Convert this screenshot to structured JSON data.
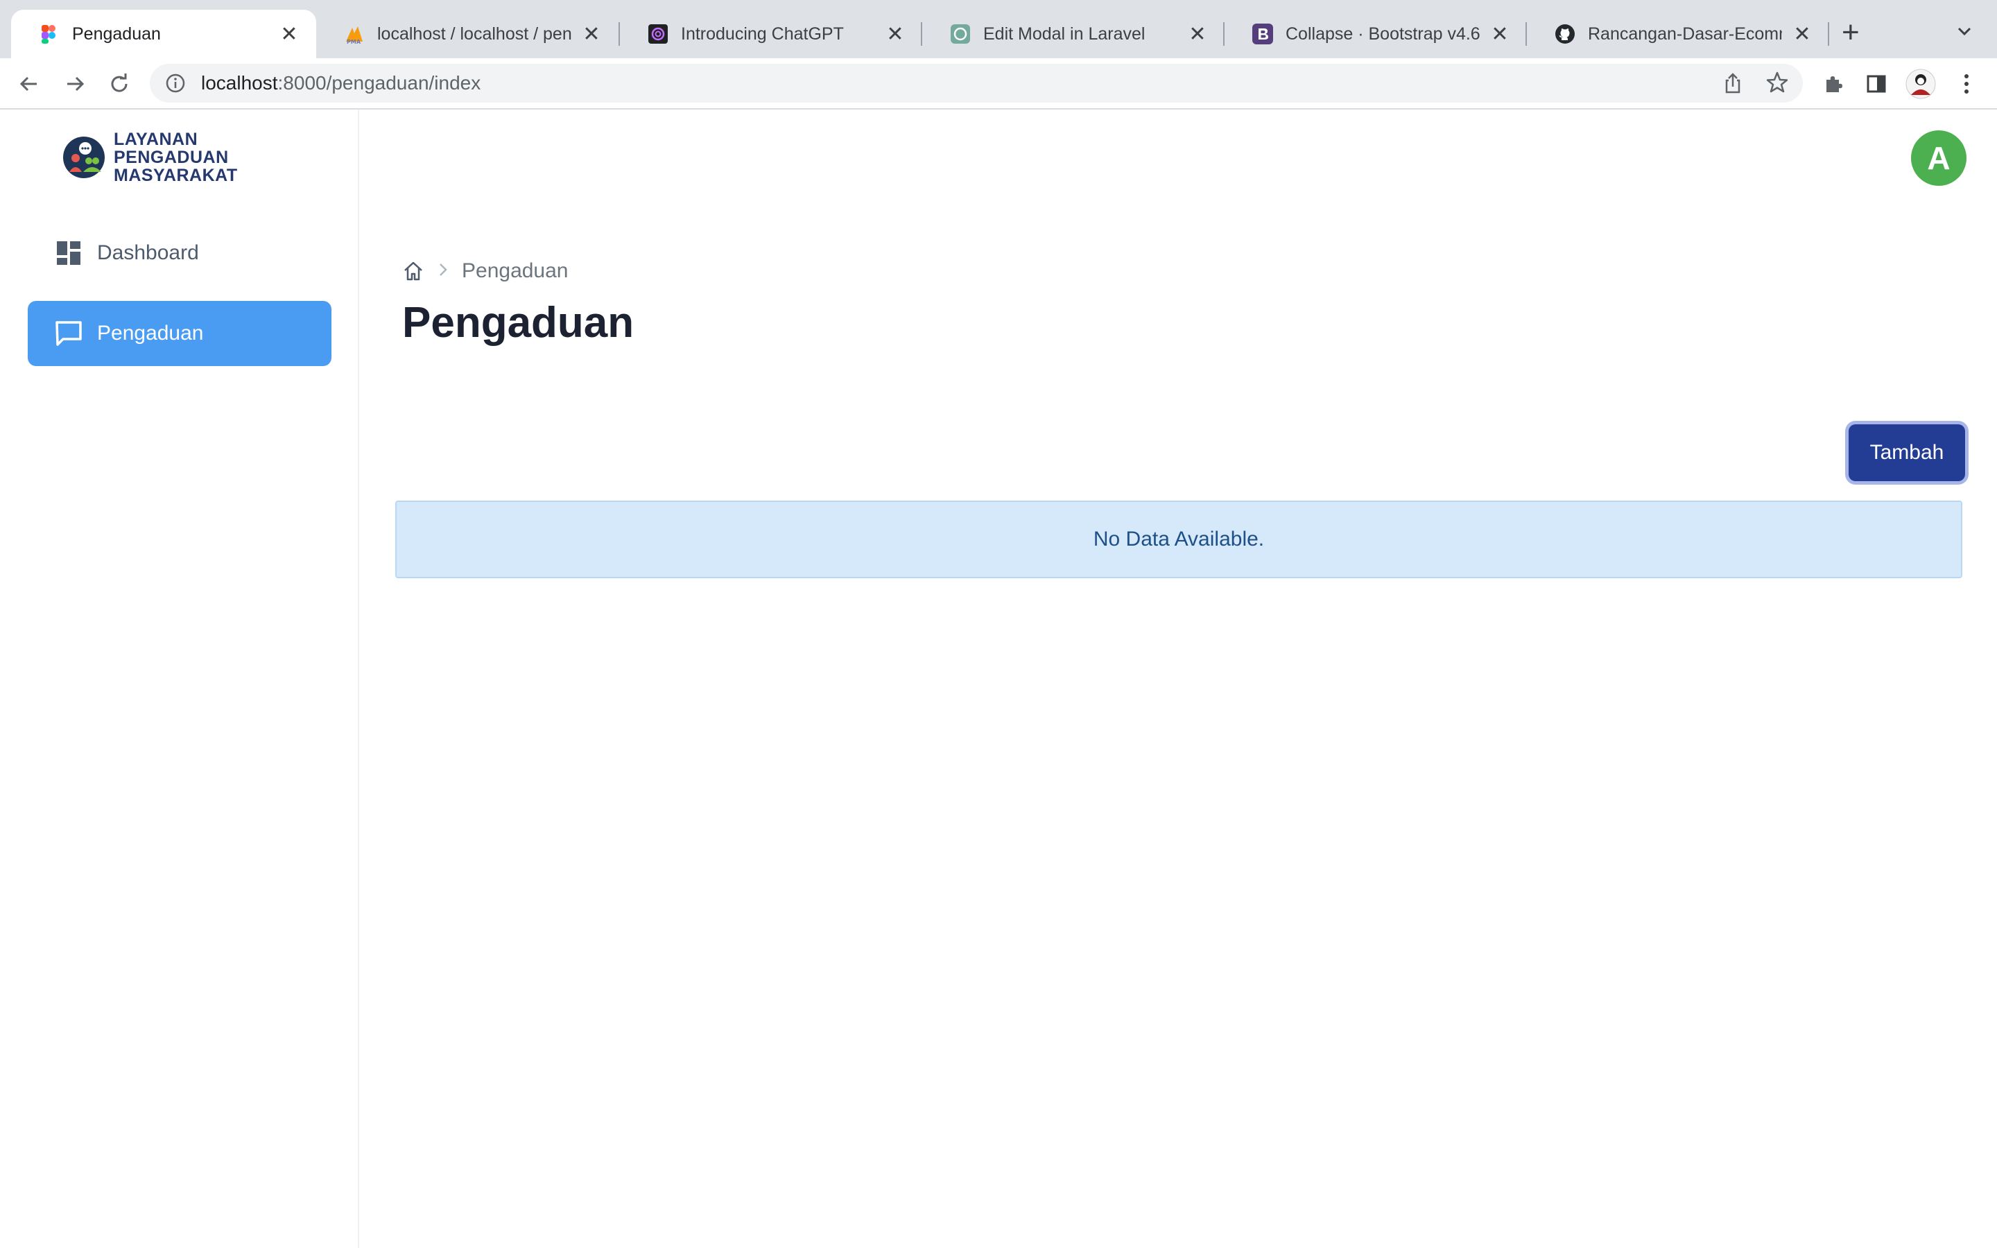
{
  "browser": {
    "tabs": [
      {
        "title": "Pengaduan",
        "active": true
      },
      {
        "title": "localhost / localhost / peng",
        "active": false
      },
      {
        "title": "Introducing ChatGPT",
        "active": false
      },
      {
        "title": "Edit Modal in Laravel",
        "active": false
      },
      {
        "title": "Collapse · Bootstrap v4.6",
        "active": false
      },
      {
        "title": "Rancangan-Dasar-Ecomme",
        "active": false
      }
    ],
    "new_tab_label": "+",
    "close_glyph": "✕",
    "url_host": "localhost",
    "url_path": ":8000/pengaduan/index"
  },
  "sidebar": {
    "brand": [
      "LAYANAN",
      "PENGADUAN",
      "MASYARAKAT"
    ],
    "items": [
      {
        "label": "Dashboard",
        "icon": "grid-icon",
        "active": false
      },
      {
        "label": "Pengaduan",
        "icon": "chat-icon",
        "active": true
      }
    ]
  },
  "header": {
    "avatar_initial": "A"
  },
  "main": {
    "breadcrumb": [
      "Pengaduan"
    ],
    "title": "Pengaduan",
    "add_button": "Tambah",
    "empty_message": "No Data Available."
  },
  "colors": {
    "accent": "#4a9cf2",
    "button": "#233c94",
    "avatar": "#4caf50",
    "alert_bg": "#d6e9fb"
  }
}
